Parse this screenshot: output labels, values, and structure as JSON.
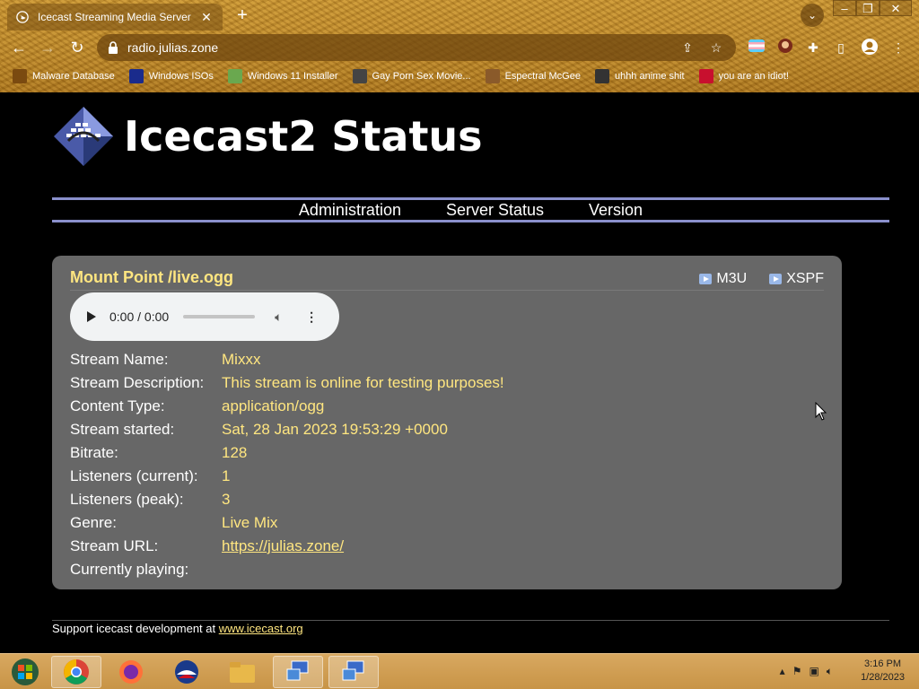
{
  "browser": {
    "tab_title": "Icecast Streaming Media Server",
    "url": "radio.julias.zone",
    "bookmarks": [
      {
        "label": "Malware Database",
        "color": "#7a4a10"
      },
      {
        "label": "Windows ISOs",
        "color": "#1a2b8c"
      },
      {
        "label": "Windows 11 Installer",
        "color": "#6aa84f"
      },
      {
        "label": "Gay Porn Sex Movie...",
        "color": "#444444"
      },
      {
        "label": "Espectral McGee",
        "color": "#8a5a2a"
      },
      {
        "label": "uhhh anime shit",
        "color": "#333333"
      },
      {
        "label": "you are an idiot!",
        "color": "#c8102e"
      }
    ]
  },
  "page": {
    "title": "Icecast2 Status",
    "nav": [
      "Administration",
      "Server Status",
      "Version"
    ],
    "mount": {
      "title": "Mount Point /live.ogg",
      "m3u": "M3U",
      "xspf": "XSPF",
      "player_time": "0:00 / 0:00",
      "fields": [
        {
          "key": "Stream Name:",
          "value": "Mixxx"
        },
        {
          "key": "Stream Description:",
          "value": "This stream is online for testing purposes!"
        },
        {
          "key": "Content Type:",
          "value": "application/ogg"
        },
        {
          "key": "Stream started:",
          "value": "Sat, 28 Jan 2023 19:53:29 +0000"
        },
        {
          "key": "Bitrate:",
          "value": "128"
        },
        {
          "key": "Listeners (current):",
          "value": "1"
        },
        {
          "key": "Listeners (peak):",
          "value": "3"
        },
        {
          "key": "Genre:",
          "value": "Live Mix"
        },
        {
          "key": "Stream URL:",
          "value": "https://julias.zone/",
          "link": true
        },
        {
          "key": "Currently playing:",
          "value": ""
        }
      ]
    },
    "footer_text": "Support icecast development at ",
    "footer_link": "www.icecast.org"
  },
  "taskbar": {
    "time": "3:16 PM",
    "date": "1/28/2023"
  },
  "colors": {
    "accent_yellow": "#ffe680",
    "nav_rule": "#8a90cc",
    "panel_bg": "#676767"
  }
}
